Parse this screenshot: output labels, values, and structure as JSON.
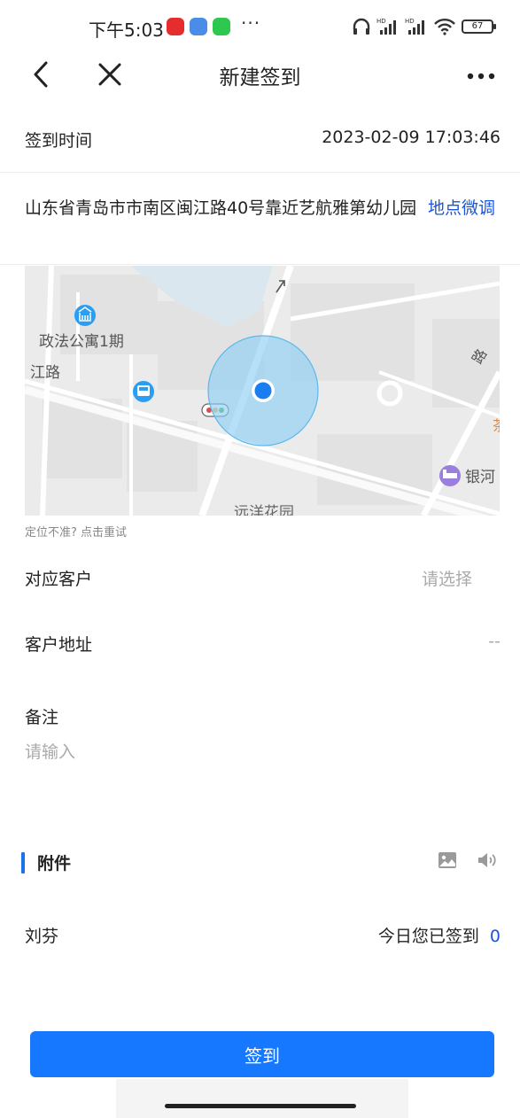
{
  "status_bar": {
    "time": "下午5:03",
    "battery": "67",
    "more": "···"
  },
  "nav": {
    "title": "新建签到"
  },
  "checkin_time": {
    "label": "签到时间",
    "value": "2023-02-09 17:03:46"
  },
  "location": {
    "address": "山东省青岛市市南区闽江路40号靠近艺航雅第幼儿园",
    "adjust_label": "地点微调"
  },
  "map": {
    "labels": {
      "poi_1": "政法公寓1期",
      "road_1": "江路",
      "hotel": "银河",
      "garden": "远洋花园",
      "road_2": "路",
      "edge_char": "茶"
    },
    "colors": {
      "accuracy_fill": "#8fd0f4",
      "dot": "#1a7df0",
      "poi": "#2a9df4",
      "hotel": "#9b7fdc"
    }
  },
  "locate_retry": "定位不准? 点击重试",
  "customer": {
    "label": "对应客户",
    "placeholder": "请选择"
  },
  "customer_address": {
    "label": "客户地址",
    "value": "--"
  },
  "remark": {
    "label": "备注",
    "placeholder": "请输入"
  },
  "attachment": {
    "title": "附件",
    "icons": [
      "image-icon",
      "audio-icon"
    ]
  },
  "user": {
    "name": "刘芬",
    "today_label": "今日您已签到",
    "today_count": "0"
  },
  "submit_label": "签到",
  "accent_color": "#1677ff"
}
